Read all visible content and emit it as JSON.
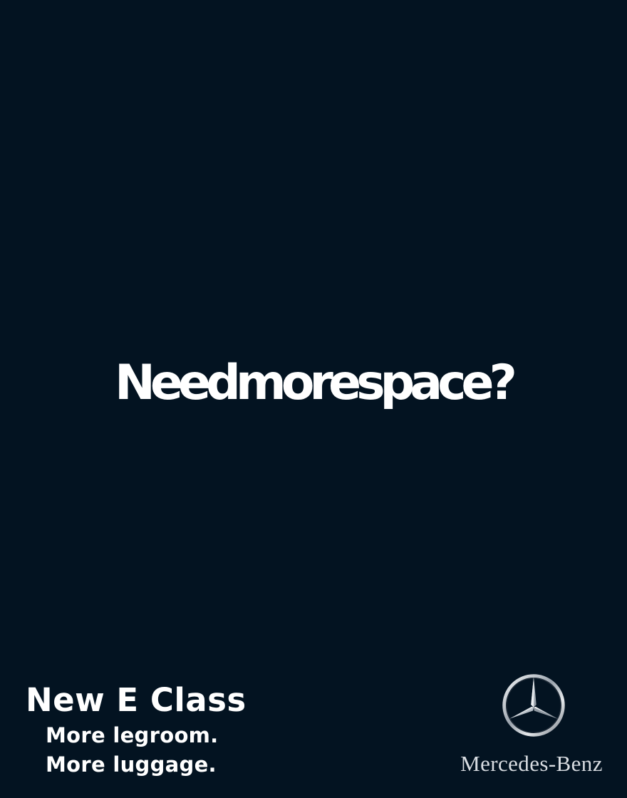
{
  "ad": {
    "headline": "Needmorespace?",
    "model_name": "New E Class",
    "taglines": [
      "More legroom.",
      "More luggage."
    ],
    "brand_name": "Mercedes-Benz",
    "logo_icon": "mercedes-star-icon"
  },
  "colors": {
    "background": "#031321",
    "text": "#ffffff",
    "logo_silver": "#d8dde3"
  }
}
